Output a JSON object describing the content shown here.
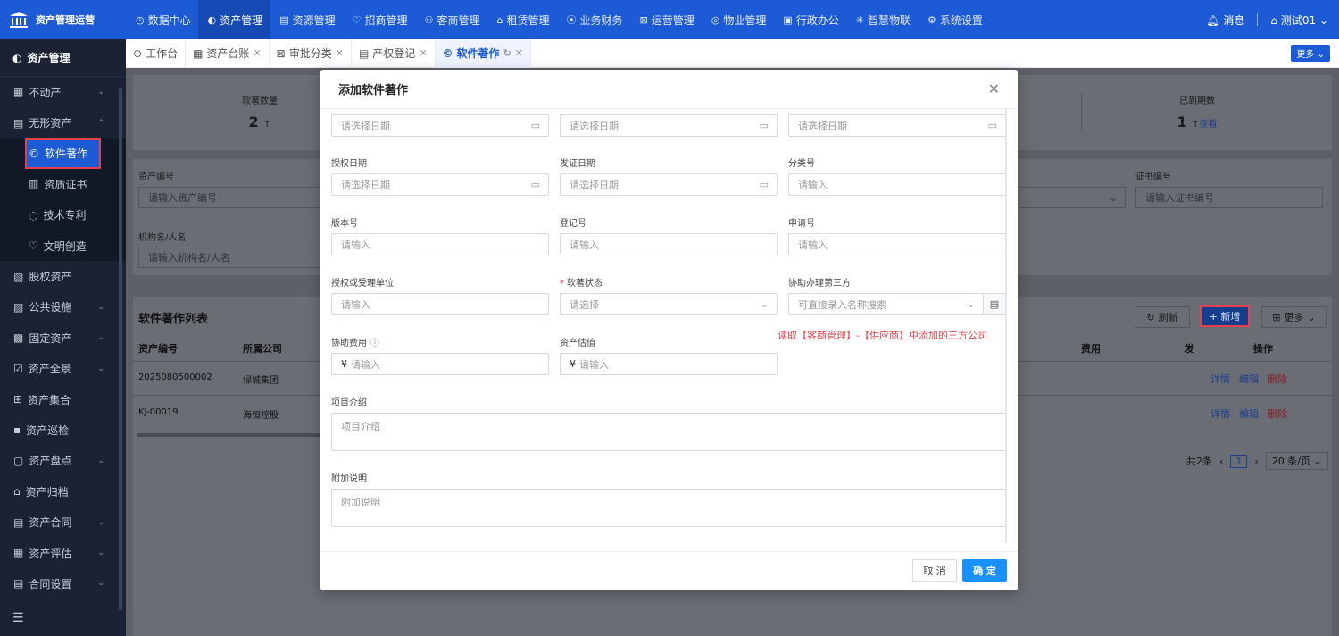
{
  "brand": {
    "title": "资产管理运营"
  },
  "topnav": {
    "items": [
      {
        "icon": "◷",
        "label": "数据中心"
      },
      {
        "icon": "◐",
        "label": "资产管理"
      },
      {
        "icon": "▤",
        "label": "资源管理"
      },
      {
        "icon": "♡",
        "label": "招商管理"
      },
      {
        "icon": "⚇",
        "label": "客商管理"
      },
      {
        "icon": "⌂",
        "label": "租赁管理"
      },
      {
        "icon": "⦿",
        "label": "业务财务"
      },
      {
        "icon": "⊠",
        "label": "运营管理"
      },
      {
        "icon": "◎",
        "label": "物业管理"
      },
      {
        "icon": "▣",
        "label": "行政办公"
      },
      {
        "icon": "✳",
        "label": "智慧物联"
      },
      {
        "icon": "⚙",
        "label": "系统设置"
      }
    ],
    "messages": "消息",
    "user": "测试01"
  },
  "sidebar": {
    "header": "资产管理",
    "items": [
      {
        "icon": "▦",
        "label": "不动产"
      },
      {
        "icon": "▤",
        "label": "无形资产"
      },
      {
        "icon": "©",
        "label": "软件著作"
      },
      {
        "icon": "▥",
        "label": "资质证书"
      },
      {
        "icon": "◌",
        "label": "技术专利"
      },
      {
        "icon": "♡",
        "label": "文明创造"
      },
      {
        "icon": "▧",
        "label": "股权资产"
      },
      {
        "icon": "▨",
        "label": "公共设施"
      },
      {
        "icon": "▩",
        "label": "固定资产"
      },
      {
        "icon": "☑",
        "label": "资产全景"
      },
      {
        "icon": "⊞",
        "label": "资产集合"
      },
      {
        "icon": "▪",
        "label": "资产巡检"
      },
      {
        "icon": "▢",
        "label": "资产盘点"
      },
      {
        "icon": "⌂",
        "label": "资产归档"
      },
      {
        "icon": "▤",
        "label": "资产合同"
      },
      {
        "icon": "▦",
        "label": "资产评估"
      },
      {
        "icon": "▤",
        "label": "合同设置"
      }
    ]
  },
  "tabs": [
    {
      "icon": "⊙",
      "label": "工作台"
    },
    {
      "icon": "▦",
      "label": "资产台账"
    },
    {
      "icon": "⊠",
      "label": "审批分类"
    },
    {
      "icon": "▤",
      "label": "产权登记"
    },
    {
      "icon": "©",
      "label": "软件著作"
    }
  ],
  "tabs_more": "更多",
  "stats": [
    {
      "label": "软著数量",
      "value": "2",
      "suffix": "↑"
    },
    {
      "label": "已到期数",
      "value": "1",
      "suffix": "↑",
      "link": "查看"
    }
  ],
  "filters": {
    "asset_no_label": "资产编号",
    "asset_no_placeholder": "请输入资产编号",
    "org_label": "机构名/人名",
    "org_placeholder": "请输入机构名/人名",
    "cert_label": "证书编号",
    "cert_placeholder": "请输入证书编号"
  },
  "list": {
    "title": "软件著作列表",
    "refresh": "刷新",
    "add": "+ 新增",
    "more": "更多",
    "columns": [
      "资产编号",
      "所属公司",
      "费用",
      "发",
      "操作"
    ],
    "rows": [
      {
        "asset_no": "2025080500002",
        "company": "绿城集团"
      },
      {
        "asset_no": "KJ-00019",
        "company": "海恒控股"
      }
    ],
    "ops": {
      "detail": "详情",
      "edit": "编辑",
      "delete": "删除"
    },
    "total": "共2条",
    "page": "1",
    "page_size": "20 条/页"
  },
  "modal": {
    "title": "添加软件著作",
    "date_placeholder": "请选择日期",
    "input_placeholder": "请输入",
    "select_placeholder": "请选择",
    "fields": {
      "auth_date": "授权日期",
      "issue_date": "发证日期",
      "category_no": "分类号",
      "version_no": "版本号",
      "reg_no": "登记号",
      "apply_no": "申请号",
      "auth_unit": "授权或受理单位",
      "status": "软著状态",
      "third_party": "协助办理第三方",
      "assist_fee": "协助费用",
      "valuation": "资产估值",
      "project_intro": "项目介绍",
      "extra_note": "附加说明"
    },
    "third_party_placeholder": "可直接录入名称搜索",
    "money_placeholder": "请输入",
    "currency": "¥",
    "annotation": "读取【客商管理】-【供应商】中添加的三方公司",
    "cancel": "取 消",
    "ok": "确 定"
  }
}
